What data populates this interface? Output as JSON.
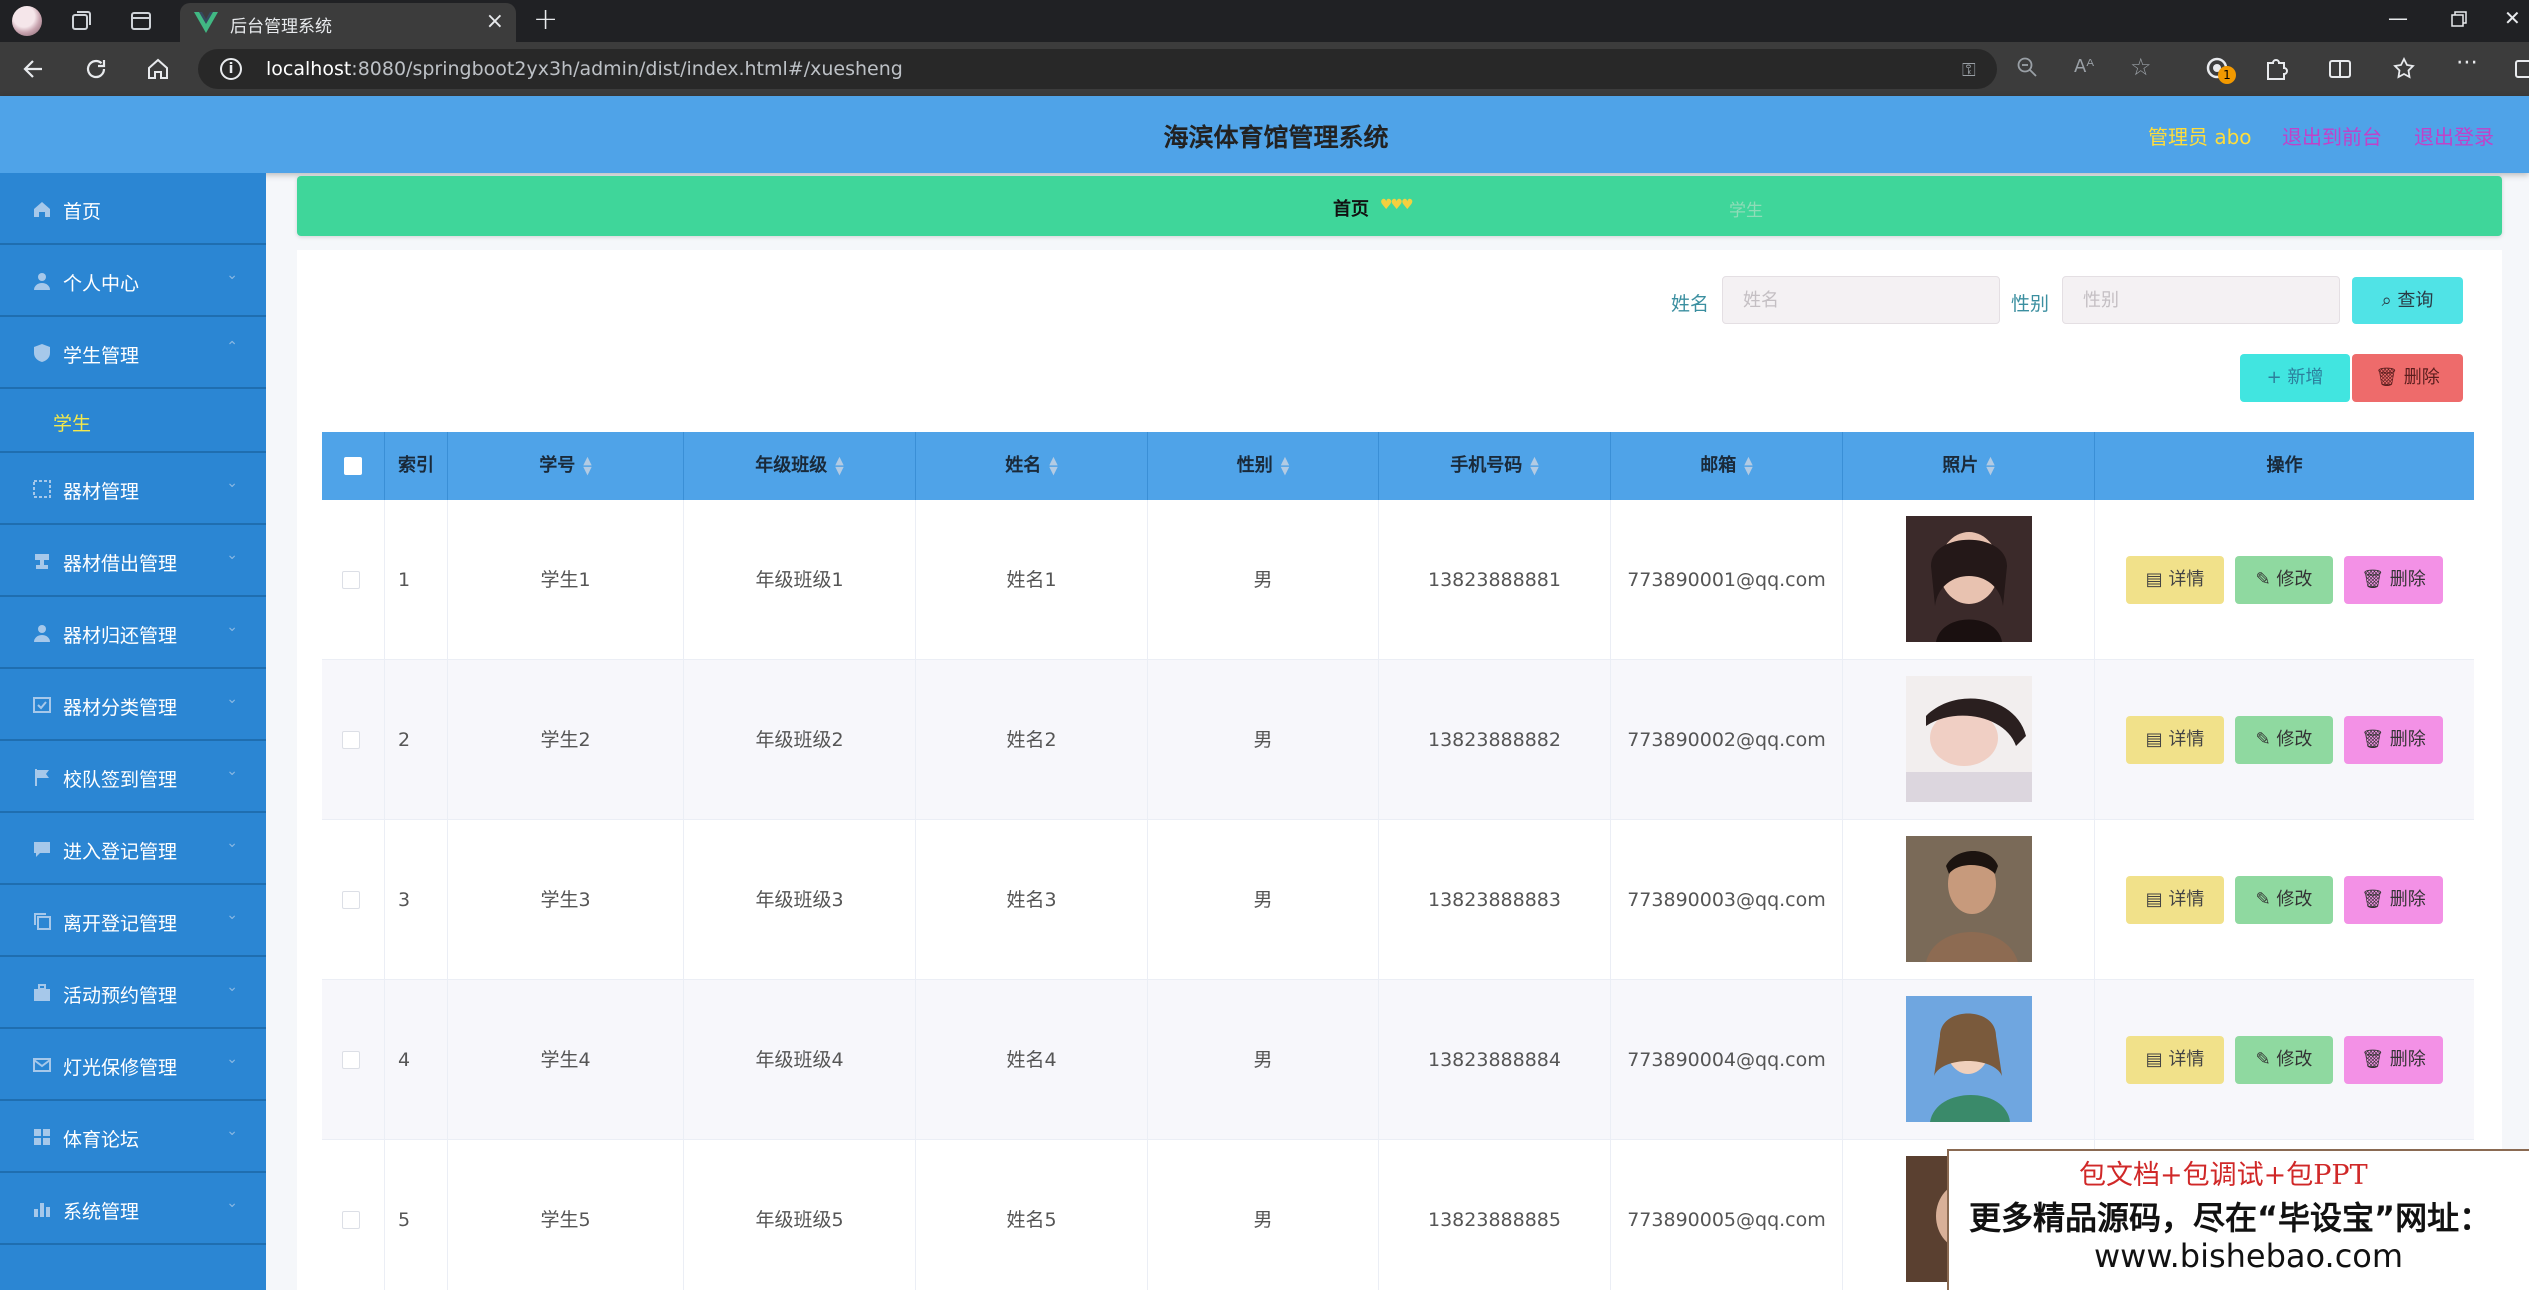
{
  "browser": {
    "tab_title": "后台管理系统",
    "url_host": "localhost",
    "url_rest": ":8080/springboot2yx3h/admin/dist/index.html#/xuesheng",
    "extension_badge": "1"
  },
  "header": {
    "title": "海滨体育馆管理系统",
    "user": "管理员 abo",
    "back_front": "退出到前台",
    "logout": "退出登录"
  },
  "sidebar": {
    "items": [
      {
        "label": "首页",
        "icon": "home-icon"
      },
      {
        "label": "个人中心",
        "icon": "user-icon"
      },
      {
        "label": "学生管理",
        "icon": "shield-icon"
      },
      {
        "label": "器材管理",
        "icon": "grid-dashed-icon"
      },
      {
        "label": "器材借出管理",
        "icon": "stamp-icon"
      },
      {
        "label": "器材归还管理",
        "icon": "user-icon"
      },
      {
        "label": "器材分类管理",
        "icon": "check-box-icon"
      },
      {
        "label": "校队签到管理",
        "icon": "flag-icon"
      },
      {
        "label": "进入登记管理",
        "icon": "message-icon"
      },
      {
        "label": "离开登记管理",
        "icon": "copy-icon"
      },
      {
        "label": "活动预约管理",
        "icon": "briefcase-icon"
      },
      {
        "label": "灯光保修管理",
        "icon": "mail-icon"
      },
      {
        "label": "体育论坛",
        "icon": "grid-icon"
      },
      {
        "label": "系统管理",
        "icon": "bar-chart-icon"
      }
    ],
    "sub_item": "学生"
  },
  "breadcrumb": {
    "home": "首页",
    "current": "学生"
  },
  "search": {
    "name_label": "姓名",
    "name_placeholder": "姓名",
    "gender_label": "性别",
    "gender_placeholder": "性别",
    "query_button": "查询"
  },
  "actions": {
    "add": "新增",
    "delete": "删除"
  },
  "table": {
    "columns": [
      "索引",
      "学号",
      "年级班级",
      "姓名",
      "性别",
      "手机号码",
      "邮箱",
      "照片",
      "操作"
    ],
    "rows": [
      {
        "index": "1",
        "student_no": "学生1",
        "class": "年级班级1",
        "name": "姓名1",
        "gender": "男",
        "phone": "13823888881",
        "email": "773890001@qq.com"
      },
      {
        "index": "2",
        "student_no": "学生2",
        "class": "年级班级2",
        "name": "姓名2",
        "gender": "男",
        "phone": "13823888882",
        "email": "773890002@qq.com"
      },
      {
        "index": "3",
        "student_no": "学生3",
        "class": "年级班级3",
        "name": "姓名3",
        "gender": "男",
        "phone": "13823888883",
        "email": "773890003@qq.com"
      },
      {
        "index": "4",
        "student_no": "学生4",
        "class": "年级班级4",
        "name": "姓名4",
        "gender": "男",
        "phone": "13823888884",
        "email": "773890004@qq.com"
      },
      {
        "index": "5",
        "student_no": "学生5",
        "class": "年级班级5",
        "name": "姓名5",
        "gender": "男",
        "phone": "13823888885",
        "email": "773890005@qq.com"
      }
    ],
    "row_actions": {
      "detail": "详情",
      "edit": "修改",
      "remove": "删除"
    }
  },
  "ad": {
    "line1": "包文档+包调试+包PPT",
    "line2": "更多精品源码，尽在“毕设宝”网址：",
    "line3": "www.bishebao.com"
  },
  "colors": {
    "header": "#4fa3e8",
    "sidebar": "#2b86d3",
    "breadcrumb": "#3fd69a",
    "accent_user": "#ffdd3a",
    "accent_link": "#c042c9"
  }
}
